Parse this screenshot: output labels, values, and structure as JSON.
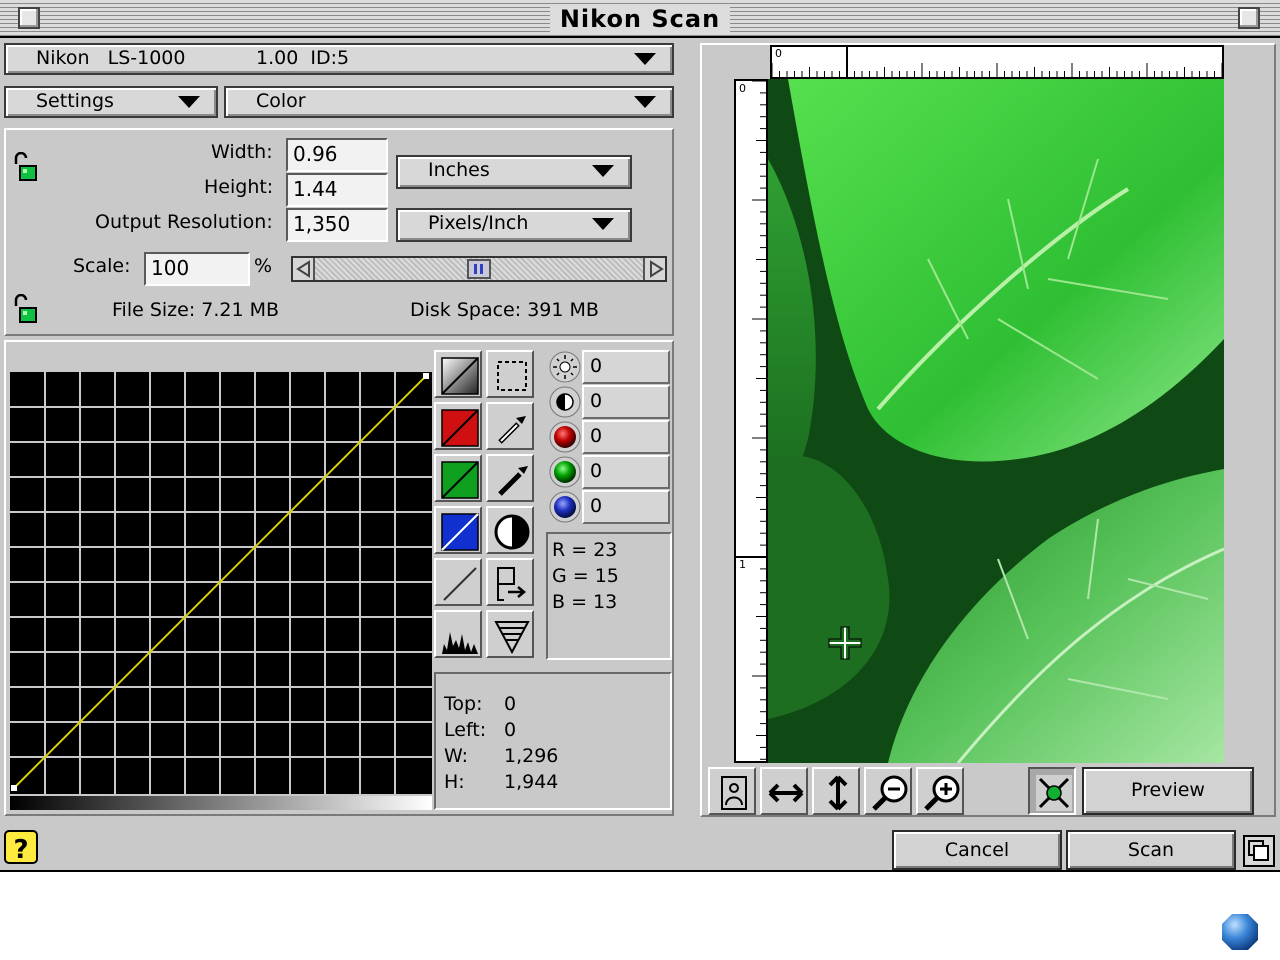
{
  "window": {
    "title": "Nikon Scan"
  },
  "scanner": {
    "model": "Nikon   LS-1000",
    "version_id": "1.00  ID:5"
  },
  "menus": {
    "settings": "Settings",
    "mode": "Color"
  },
  "dimensions": {
    "width_label": "Width:",
    "width_value": "0.96",
    "height_label": "Height:",
    "height_value": "1.44",
    "resolution_label": "Output Resolution:",
    "resolution_value": "1,350",
    "units": "Inches",
    "res_units": "Pixels/Inch",
    "scale_label": "Scale:",
    "scale_value": "100",
    "percent": "%",
    "scale_position": 0.5,
    "file_size": "File Size: 7.21 MB",
    "disk_space": "Disk Space: 391 MB"
  },
  "adjustments": {
    "brightness": "0",
    "contrast": "0",
    "red": "0",
    "green": "0",
    "blue": "0"
  },
  "rgb_readout": {
    "r": "R = 23",
    "g": "G = 15",
    "b": "B = 13"
  },
  "selection": {
    "top_label": "Top:",
    "top": "0",
    "left_label": "Left:",
    "left": "0",
    "w_label": "W:",
    "w": "1,296",
    "h_label": "H:",
    "h": "1,944"
  },
  "ruler": {
    "h_origin": "0",
    "v_origin": "0",
    "v_mark": "1"
  },
  "buttons": {
    "preview": "Preview",
    "cancel": "Cancel",
    "scan": "Scan"
  },
  "colors": {
    "curve_line": "#d8d000",
    "red_channel": "#d01010",
    "green_channel": "#10a020",
    "blue_channel": "#1030d0",
    "leaf": "#37c23a"
  }
}
